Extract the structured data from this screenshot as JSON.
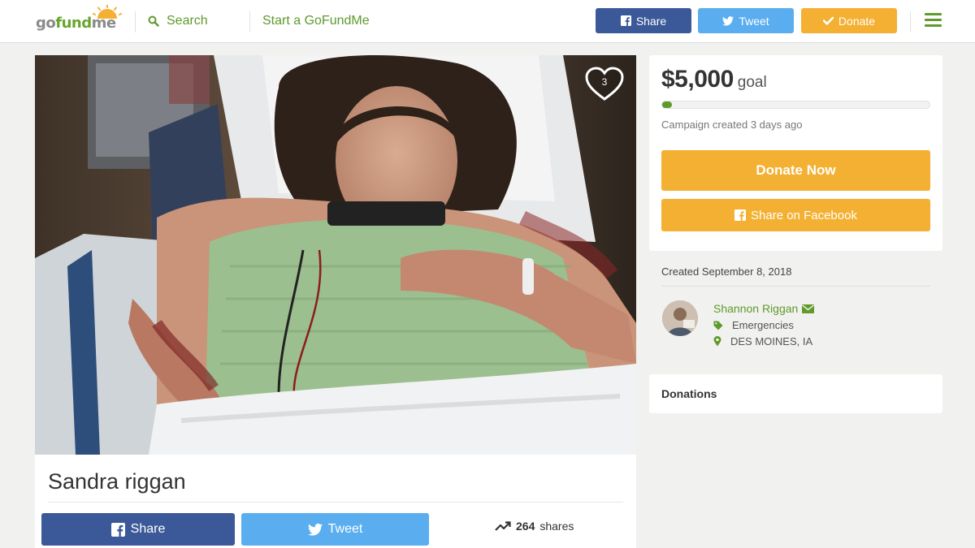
{
  "header": {
    "logo": {
      "go": "go",
      "fund": "fund",
      "me": "me"
    },
    "search_label": "Search",
    "start_link": "Start a GoFundMe",
    "share_label": "Share",
    "tweet_label": "Tweet",
    "donate_label": "Donate"
  },
  "campaign": {
    "title": "Sandra riggan",
    "heart_count": "3",
    "share_button": "Share",
    "tweet_button": "Tweet",
    "shares_count": "264",
    "shares_label": "shares"
  },
  "goal": {
    "amount": "$5,000",
    "word": "goal",
    "progress_fraction": 0.01,
    "created_ago": "Campaign created 3 days ago",
    "donate_now": "Donate Now",
    "share_facebook": "Share on Facebook"
  },
  "organizer": {
    "created_date": "Created September 8, 2018",
    "name": "Shannon Riggan",
    "category": "Emergencies",
    "location": "DES MOINES, IA"
  },
  "donations": {
    "title": "Donations"
  },
  "colors": {
    "brand_green": "#5f9a2b",
    "facebook_blue": "#3b5998",
    "twitter_blue": "#5aaef0",
    "donate_orange": "#f4b032"
  },
  "icons": [
    "search-icon",
    "facebook-icon",
    "twitter-icon",
    "check-icon",
    "menu-icon",
    "heart-icon",
    "trending-icon",
    "envelope-icon",
    "tag-icon",
    "map-pin-icon"
  ]
}
